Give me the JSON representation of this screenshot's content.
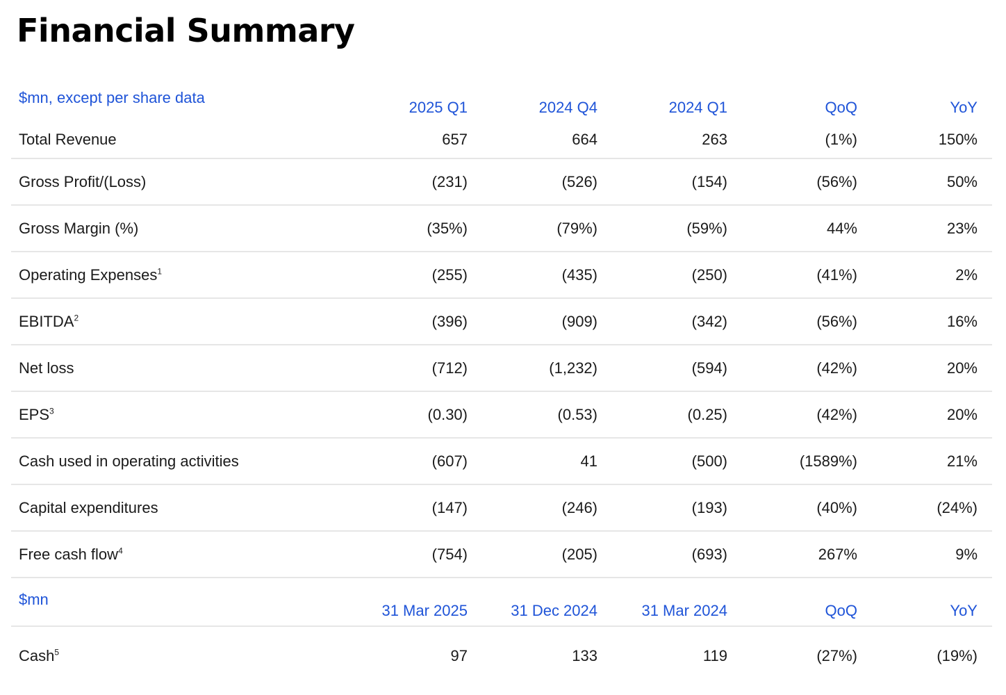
{
  "title": "Financial Summary",
  "section1": {
    "header": {
      "label": "$mn, except per share data",
      "columns": [
        "2025 Q1",
        "2024 Q4",
        "2024 Q1",
        "QoQ",
        "YoY"
      ]
    },
    "rows": [
      {
        "label": "Total Revenue",
        "sup": "",
        "values": [
          "657",
          "664",
          "263",
          "(1%)",
          "150%"
        ]
      },
      {
        "label": "Gross Profit/(Loss)",
        "sup": "",
        "values": [
          "(231)",
          "(526)",
          "(154)",
          "(56%)",
          "50%"
        ]
      },
      {
        "label": "Gross Margin (%)",
        "sup": "",
        "values": [
          "(35%)",
          "(79%)",
          "(59%)",
          "44%",
          "23%"
        ]
      },
      {
        "label": "Operating Expenses",
        "sup": "1",
        "values": [
          "(255)",
          "(435)",
          "(250)",
          "(41%)",
          "2%"
        ]
      },
      {
        "label": "EBITDA",
        "sup": "2",
        "values": [
          "(396)",
          "(909)",
          "(342)",
          "(56%)",
          "16%"
        ]
      },
      {
        "label": "Net loss",
        "sup": "",
        "values": [
          "(712)",
          "(1,232)",
          "(594)",
          "(42%)",
          "20%"
        ]
      },
      {
        "label": "EPS",
        "sup": "3",
        "values": [
          "(0.30)",
          "(0.53)",
          "(0.25)",
          "(42%)",
          "20%"
        ]
      },
      {
        "label": "Cash used in operating activities",
        "sup": "",
        "values": [
          "(607)",
          "41",
          "(500)",
          "(1589%)",
          "21%"
        ]
      },
      {
        "label": "Capital expenditures",
        "sup": "",
        "values": [
          "(147)",
          "(246)",
          "(193)",
          "(40%)",
          "(24%)"
        ]
      },
      {
        "label": "Free cash flow",
        "sup": "4",
        "values": [
          "(754)",
          "(205)",
          "(693)",
          "267%",
          "9%"
        ]
      }
    ]
  },
  "section2": {
    "header": {
      "label": "$mn",
      "columns": [
        "31 Mar 2025",
        "31 Dec 2024",
        "31 Mar 2024",
        "QoQ",
        "YoY"
      ]
    },
    "rows": [
      {
        "label": "Cash",
        "sup": "5",
        "values": [
          "97",
          "133",
          "119",
          "(27%)",
          "(19%)"
        ]
      }
    ]
  },
  "colors": {
    "header_text": "#1f54d8",
    "row_divider": "#e6e6e6"
  }
}
